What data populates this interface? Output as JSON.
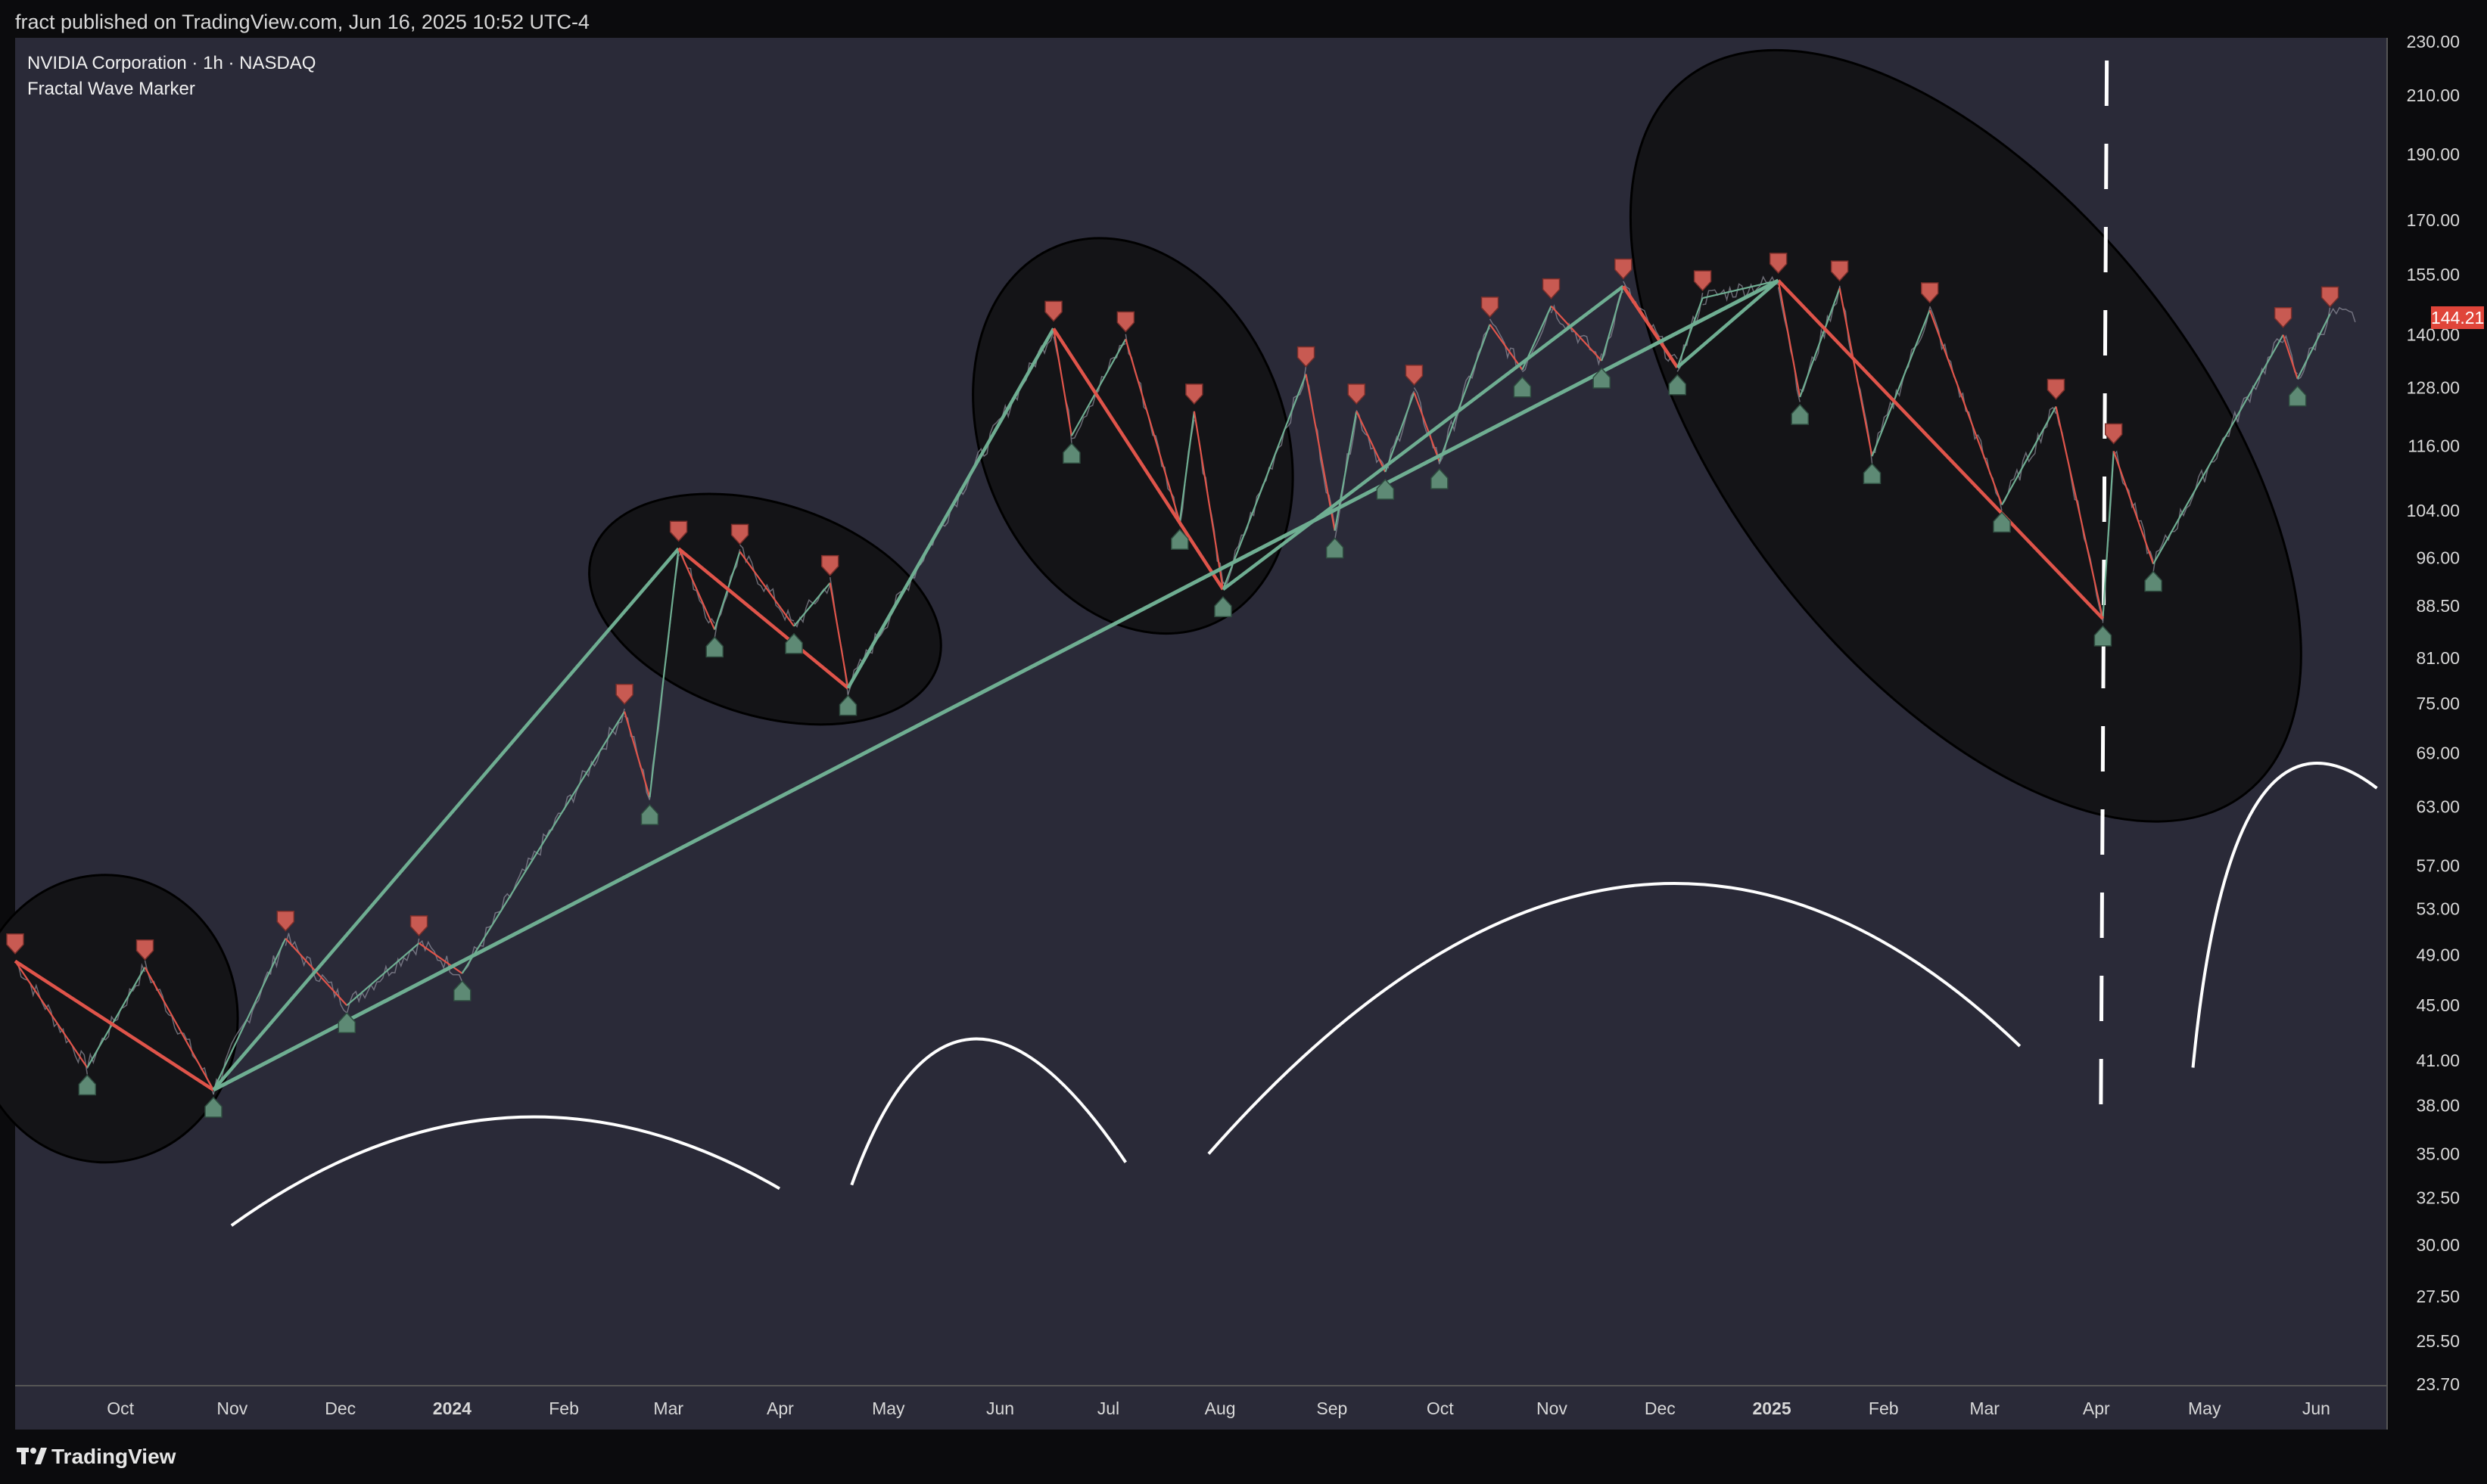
{
  "header": {
    "published": "fract published on TradingView.com, Jun 16, 2025 10:52 UTC-4"
  },
  "legend": {
    "title": "NVIDIA Corporation · 1h · NASDAQ",
    "indicator": "Fractal Wave Marker"
  },
  "footer": {
    "brand": "TradingView"
  },
  "colors": {
    "background": "#2a2a38",
    "up": "#6fae92",
    "down": "#e0544a",
    "annotation_fill": "#141417",
    "drawing": "#ffffff"
  },
  "last_price": "144.21",
  "chart_data": {
    "type": "line",
    "title": "NVIDIA Corporation · 1h · NASDAQ",
    "scale": "log",
    "ylim": [
      23.7,
      230
    ],
    "y_ticks": [
      "230.00",
      "210.00",
      "190.00",
      "170.00",
      "155.00",
      "140.00",
      "128.00",
      "116.00",
      "104.00",
      "96.00",
      "88.50",
      "81.00",
      "75.00",
      "69.00",
      "63.00",
      "57.00",
      "53.00",
      "49.00",
      "45.00",
      "41.00",
      "38.00",
      "35.00",
      "32.50",
      "30.00",
      "27.50",
      "25.50",
      "23.70"
    ],
    "x_ticks": [
      "Oct",
      "Nov",
      "Dec",
      "2024",
      "Feb",
      "Mar",
      "Apr",
      "May",
      "Jun",
      "Jul",
      "Aug",
      "Sep",
      "Oct",
      "Nov",
      "Dec",
      "2025",
      "Feb",
      "Mar",
      "Apr",
      "May",
      "Jun"
    ],
    "x_range": [
      "2023-09-06",
      "2025-06-24"
    ],
    "grid": false,
    "series": [
      {
        "name": "Fractal Wave Marker",
        "swings": [
          {
            "date": "2023-09-06",
            "price": 48.5,
            "kind": "high"
          },
          {
            "date": "2023-09-26",
            "price": 40.5,
            "kind": "low"
          },
          {
            "date": "2023-10-12",
            "price": 48.0,
            "kind": "high"
          },
          {
            "date": "2023-10-31",
            "price": 39.0,
            "kind": "low"
          },
          {
            "date": "2023-11-20",
            "price": 50.4,
            "kind": "high"
          },
          {
            "date": "2023-12-07",
            "price": 45.0,
            "kind": "low"
          },
          {
            "date": "2023-12-27",
            "price": 50.0,
            "kind": "high"
          },
          {
            "date": "2024-01-08",
            "price": 47.5,
            "kind": "low"
          },
          {
            "date": "2024-02-22",
            "price": 74.0,
            "kind": "high"
          },
          {
            "date": "2024-02-29",
            "price": 64.0,
            "kind": "low"
          },
          {
            "date": "2024-03-08",
            "price": 97.5,
            "kind": "high"
          },
          {
            "date": "2024-03-18",
            "price": 85.0,
            "kind": "low"
          },
          {
            "date": "2024-03-25",
            "price": 97.0,
            "kind": "high"
          },
          {
            "date": "2024-04-09",
            "price": 85.5,
            "kind": "low"
          },
          {
            "date": "2024-04-19",
            "price": 92.0,
            "kind": "high"
          },
          {
            "date": "2024-04-24",
            "price": 77.0,
            "kind": "low"
          },
          {
            "date": "2024-06-20",
            "price": 141.5,
            "kind": "high"
          },
          {
            "date": "2024-06-25",
            "price": 118.0,
            "kind": "low"
          },
          {
            "date": "2024-07-10",
            "price": 139.0,
            "kind": "high"
          },
          {
            "date": "2024-07-25",
            "price": 102.0,
            "kind": "low"
          },
          {
            "date": "2024-07-29",
            "price": 123.0,
            "kind": "high"
          },
          {
            "date": "2024-08-06",
            "price": 91.0,
            "kind": "low"
          },
          {
            "date": "2024-08-29",
            "price": 131.0,
            "kind": "high"
          },
          {
            "date": "2024-09-06",
            "price": 100.5,
            "kind": "low"
          },
          {
            "date": "2024-09-12",
            "price": 123.0,
            "kind": "high"
          },
          {
            "date": "2024-09-20",
            "price": 111.0,
            "kind": "low"
          },
          {
            "date": "2024-09-28",
            "price": 127.0,
            "kind": "high"
          },
          {
            "date": "2024-10-05",
            "price": 113.0,
            "kind": "low"
          },
          {
            "date": "2024-10-19",
            "price": 142.5,
            "kind": "high"
          },
          {
            "date": "2024-10-28",
            "price": 132.0,
            "kind": "low"
          },
          {
            "date": "2024-11-05",
            "price": 147.0,
            "kind": "high"
          },
          {
            "date": "2024-11-19",
            "price": 134.0,
            "kind": "low"
          },
          {
            "date": "2024-11-25",
            "price": 152.0,
            "kind": "high"
          },
          {
            "date": "2024-12-10",
            "price": 132.5,
            "kind": "low"
          },
          {
            "date": "2024-12-17",
            "price": 149.0,
            "kind": "high"
          },
          {
            "date": "2025-01-07",
            "price": 153.5,
            "kind": "high"
          },
          {
            "date": "2025-01-13",
            "price": 126.0,
            "kind": "low"
          },
          {
            "date": "2025-01-24",
            "price": 151.5,
            "kind": "high"
          },
          {
            "date": "2025-02-02",
            "price": 114.0,
            "kind": "low"
          },
          {
            "date": "2025-02-18",
            "price": 146.0,
            "kind": "high"
          },
          {
            "date": "2025-03-10",
            "price": 105.0,
            "kind": "low"
          },
          {
            "date": "2025-03-25",
            "price": 124.0,
            "kind": "high"
          },
          {
            "date": "2025-04-07",
            "price": 86.6,
            "kind": "low"
          },
          {
            "date": "2025-04-10",
            "price": 115.0,
            "kind": "high"
          },
          {
            "date": "2025-04-21",
            "price": 95.0,
            "kind": "low"
          },
          {
            "date": "2025-05-27",
            "price": 140.0,
            "kind": "high"
          },
          {
            "date": "2025-05-31",
            "price": 130.0,
            "kind": "low"
          },
          {
            "date": "2025-06-09",
            "price": 145.0,
            "kind": "high"
          },
          {
            "date": "2025-06-16",
            "price": 144.21,
            "kind": "last"
          }
        ],
        "major_waves": [
          {
            "date": "2023-09-06",
            "price": 48.5
          },
          {
            "date": "2023-10-31",
            "price": 39.0
          },
          {
            "date": "2024-03-08",
            "price": 97.5
          },
          {
            "date": "2024-04-24",
            "price": 77.0
          },
          {
            "date": "2024-06-20",
            "price": 141.5
          },
          {
            "date": "2024-08-06",
            "price": 91.0
          },
          {
            "date": "2024-11-25",
            "price": 152.0
          },
          {
            "date": "2024-12-10",
            "price": 132.5
          },
          {
            "date": "2025-01-07",
            "price": 153.5
          },
          {
            "date": "2025-04-07",
            "price": 86.6
          }
        ],
        "trendlines": [
          {
            "from": {
              "date": "2023-10-31",
              "price": 39.0
            },
            "to": {
              "date": "2025-01-07",
              "price": 153.5
            }
          }
        ]
      }
    ]
  }
}
